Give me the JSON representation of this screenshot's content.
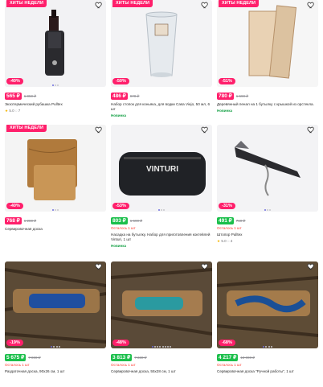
{
  "badges": {
    "hit": "ХИТЫ НЕДЕЛИ"
  },
  "colors": {
    "accent": "#ff1f6b",
    "green": "#1bbf4b",
    "stock": "#ff3b30",
    "novelty": "#1aa34a"
  },
  "icons": {
    "favorite": "heart-icon",
    "rating": "star-icon",
    "reviews": "comment-icon"
  },
  "products": [
    {
      "hit": true,
      "discount": "-40%",
      "price": "565 ₽",
      "old_price": "1 050 ₽",
      "price_style": "pink",
      "stock": "",
      "title": "Экзотермический рубашка Pulltex",
      "rating": "5.0",
      "reviews": "7",
      "novelty": "",
      "dots": 3,
      "active_dot": 0
    },
    {
      "hit": true,
      "discount": "-50%",
      "price": "486 ₽",
      "old_price": "970 ₽",
      "price_style": "pink",
      "stock": "",
      "title": "Набор стопок для коньяка, для водки Casa Viejo, 50 мл, 6 шт",
      "rating": "",
      "reviews": "",
      "novelty": "Новинка",
      "dots": 0,
      "active_dot": 0
    },
    {
      "hit": true,
      "discount": "-51%",
      "price": "780 ₽",
      "old_price": "1 590 ₽",
      "price_style": "pink",
      "stock": "",
      "title": "Деревянный пенал на 1 бутылку с крышкой из орстекла.",
      "rating": "",
      "reviews": "",
      "novelty": "Новинка",
      "dots": 0,
      "active_dot": 0
    },
    {
      "hit": true,
      "discount": "-40%",
      "price": "768 ₽",
      "old_price": "1 280 ₽",
      "price_style": "pink",
      "stock": "",
      "title": "Сервировочная доска",
      "rating": "",
      "reviews": "",
      "novelty": "",
      "dots": 3,
      "active_dot": 0
    },
    {
      "hit": false,
      "discount": "-53%",
      "price": "803 ₽",
      "old_price": "1 690 ₽",
      "price_style": "green",
      "stock": "Осталось 1 шт",
      "title": "Насадка на бутылку. Набор для приготовления коктейлей Vinturi, 1 шт",
      "rating": "",
      "reviews": "",
      "novelty": "Новинка",
      "dots": 3,
      "active_dot": 0
    },
    {
      "hit": false,
      "discount": "-31%",
      "price": "491 ₽",
      "old_price": "710 ₽",
      "price_style": "green",
      "stock": "Осталось 1 шт",
      "title": "Штопор Pulltex",
      "rating": "5.0",
      "reviews": "4",
      "novelty": "",
      "dots": 3,
      "active_dot": 0
    },
    {
      "hit": false,
      "discount": "-19%",
      "price": "5 675 ₽",
      "old_price": "7 000 ₽",
      "price_style": "green",
      "stock": "Осталось 1 шт",
      "title": "Раздаточная доска, 90х26 см, 1 шт",
      "rating": "",
      "reviews": "",
      "novelty": "",
      "dots": 4,
      "active_dot": 0
    },
    {
      "hit": false,
      "discount": "-48%",
      "price": "3 813 ₽",
      "old_price": "7 330 ₽",
      "price_style": "green",
      "stock": "Осталось 1 шт",
      "title": "Сервировочная доска, 55х28 см, 1 шт",
      "rating": "",
      "reviews": "",
      "novelty": "",
      "dots": 8,
      "active_dot": 0
    },
    {
      "hit": false,
      "discount": "-68%",
      "price": "4 217 ₽",
      "old_price": "13 000 ₽",
      "price_style": "green",
      "stock": "Осталось 1 шт",
      "title": "Сервировочная доска \"Ручной работы\", 1 шт",
      "rating": "",
      "reviews": "",
      "novelty": "",
      "dots": 4,
      "active_dot": 0
    }
  ]
}
